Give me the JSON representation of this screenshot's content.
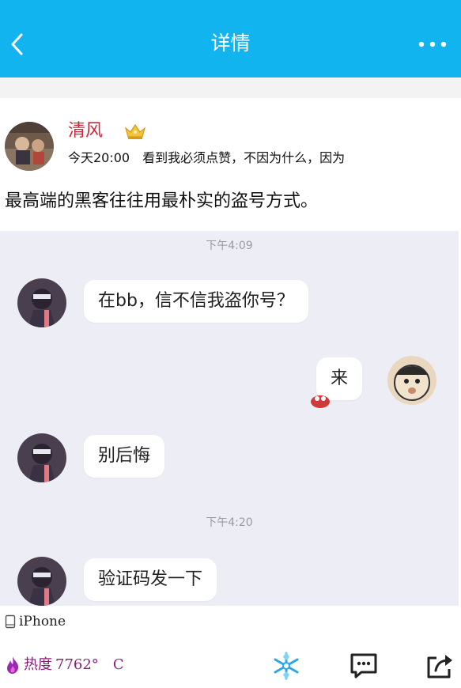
{
  "header": {
    "title": "详情"
  },
  "post": {
    "username": "清风",
    "time": "今天20:00",
    "excerpt": "看到我必须点赞，不因为什么，因为",
    "body": "最高端的黑客往往用最朴实的盗号方式。"
  },
  "embedded_chat": {
    "timestamp_1": "下午4:09",
    "msg_1": "在bb，信不信我盗你号？",
    "msg_2": "来",
    "msg_3": "别后悔",
    "timestamp_2": "下午4:20",
    "msg_4": "验证码发一下"
  },
  "device": "iPhone",
  "footer": {
    "heat_label": "热度",
    "heat_value": "7762°",
    "refresh": "C"
  },
  "colors": {
    "navbar": "#12b4ef",
    "username": "#c8283a",
    "heat": "#8a1f7a"
  }
}
